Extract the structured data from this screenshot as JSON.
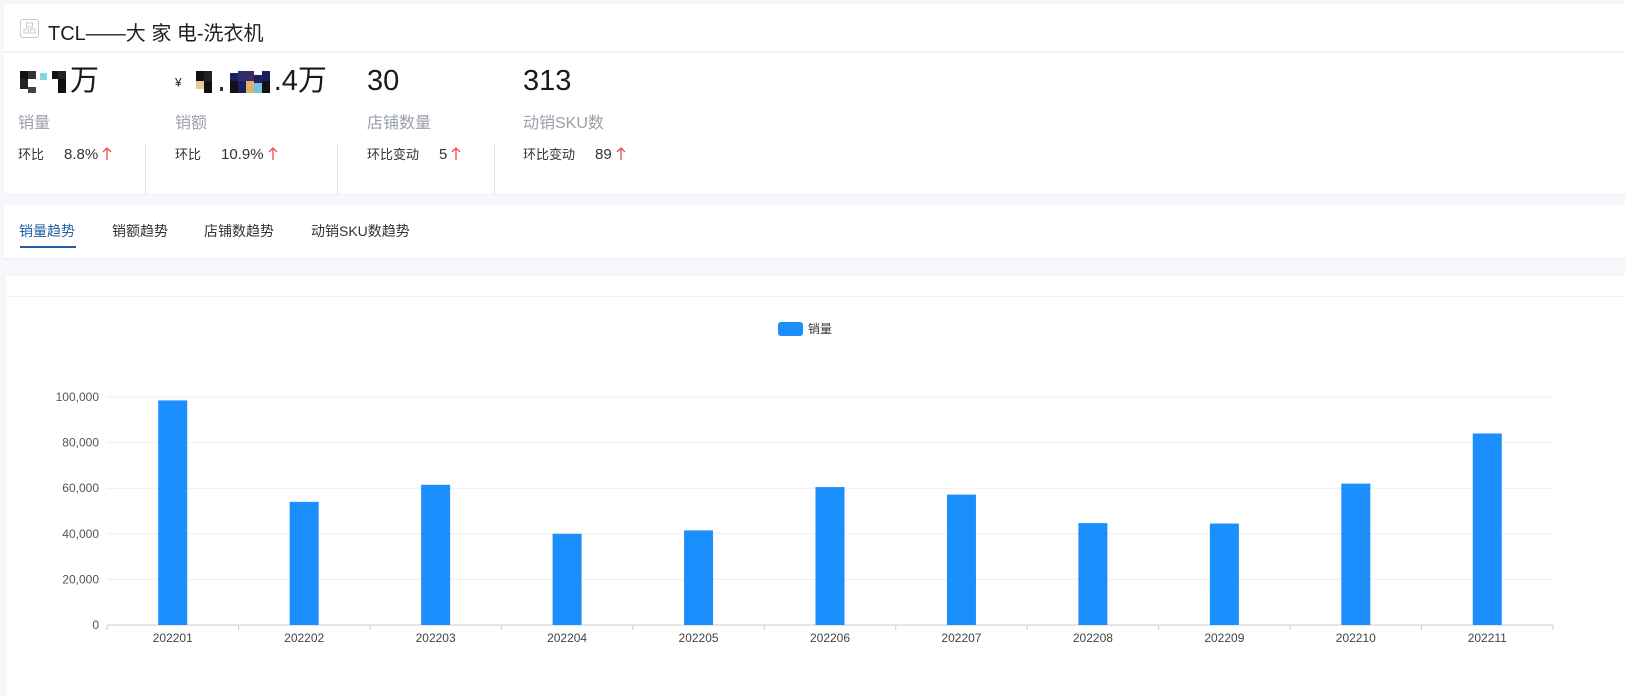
{
  "header": {
    "title": "TCL——大 家 电-洗衣机",
    "icon": "product-icon"
  },
  "stats": [
    {
      "id": "volume",
      "value_suffix": "万",
      "label": "销量",
      "change_label": "环比",
      "change_value": "8.8%",
      "trend": "up"
    },
    {
      "id": "amount",
      "value_prefix": "¥",
      "value_suffix": ".4万",
      "label": "销额",
      "change_label": "环比",
      "change_value": "10.9%",
      "trend": "up"
    },
    {
      "id": "stores",
      "value": "30",
      "label": "店铺数量",
      "change_label": "环比变动",
      "change_value": "5",
      "trend": "up"
    },
    {
      "id": "sku",
      "value": "313",
      "label": "动销SKU数",
      "change_label": "环比变动",
      "change_value": "89",
      "trend": "up"
    }
  ],
  "tabs": [
    {
      "label": "销量趋势",
      "active": true
    },
    {
      "label": "销额趋势",
      "active": false
    },
    {
      "label": "店铺数趋势",
      "active": false
    },
    {
      "label": "动销SKU数趋势",
      "active": false
    }
  ],
  "colors": {
    "bar": "#1a8ffd",
    "up_arrow": "#f04b4b",
    "active_tab": "#1f5fa6"
  },
  "chart_data": {
    "type": "bar",
    "categories": [
      "202201",
      "202202",
      "202203",
      "202204",
      "202205",
      "202206",
      "202207",
      "202208",
      "202209",
      "202210",
      "202211"
    ],
    "series": [
      {
        "name": "销量",
        "values": [
          98500,
          54000,
          61500,
          40000,
          41500,
          60500,
          57200,
          44700,
          44500,
          62000,
          84000
        ]
      }
    ],
    "ylim": [
      0,
      100000
    ],
    "yticks": [
      0,
      20000,
      40000,
      60000,
      80000,
      100000
    ],
    "ytick_labels": [
      "0",
      "20,000",
      "40,000",
      "60,000",
      "80,000",
      "100,000"
    ],
    "legend": "top-center",
    "grid": true
  }
}
